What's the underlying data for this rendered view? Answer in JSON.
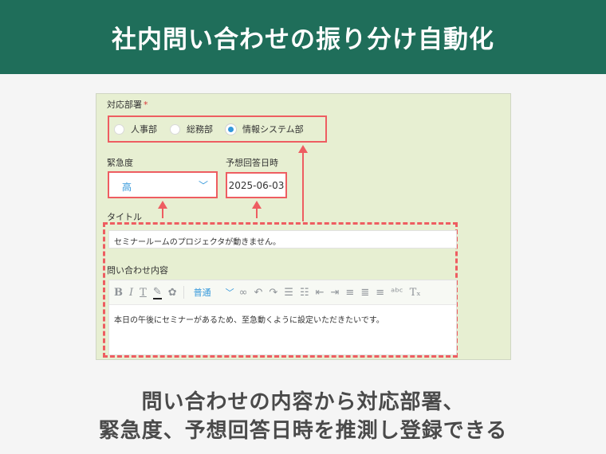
{
  "banner": {
    "title": "社内問い合わせの振り分け自動化"
  },
  "form": {
    "department_label": "対応部署",
    "required_mark": "*",
    "departments": [
      {
        "label": "人事部",
        "selected": false
      },
      {
        "label": "総務部",
        "selected": false
      },
      {
        "label": "情報システム部",
        "selected": true
      }
    ],
    "urgency_label": "緊急度",
    "urgency_value": "高",
    "due_label": "予想回答日時",
    "due_value": "2025-06-03",
    "title_label": "タイトル",
    "title_value": "セミナールームのプロジェクタが動きません。",
    "content_label": "問い合わせ内容",
    "editor_format": "普通",
    "content_value": "本日の午後にセミナーがあるため、至急動くように設定いただきたいです。"
  },
  "caption": {
    "line1": "問い合わせの内容から対応部署、",
    "line2": "緊急度、予想回答日時を推測し登録できる"
  },
  "colors": {
    "banner": "#1f6e5a",
    "highlight": "#ee5d61",
    "panel": "#e7efd2",
    "accent": "#3498db"
  }
}
